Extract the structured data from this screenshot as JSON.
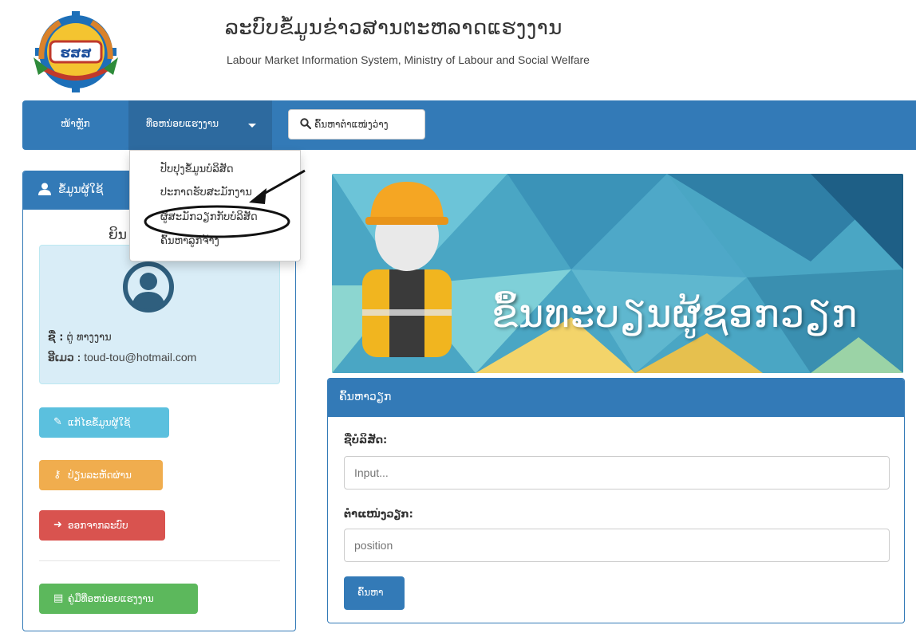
{
  "header": {
    "title": "ລະບົບຂໍ້ມູນຂ່າວສານຕະຫລາດແຮງງານ",
    "subtitle": "Labour Market Information System, Ministry of Labour and Social Welfare",
    "logo_text": "ຮສສ"
  },
  "nav": {
    "home": "ໜ້າຫຼັກ",
    "dropdown": "ທີ່ອຫນ່ອຍແຮງງານ",
    "search_button": "ຄົ້ນຫາຕໍາແໜ່ງວ່າງ"
  },
  "dropdown_menu": {
    "items": [
      "ປັບປຸງຂໍ້ມູນບໍລິສັດ",
      "ປະກາດຮັບສະມັກງານ",
      "ຜູ້ສະມັກວຽກກັບບໍລິສັດ",
      "ຄົ້ນຫາລູກຈ້າງ"
    ]
  },
  "user_panel": {
    "title": "ຂໍ້ມູນຜູ້ໃຊ້",
    "welcome": "ຍິນ",
    "name_label": "ຊື່ :",
    "name_value": "ຕູ່ ທາງງານ",
    "email_label": "ອີເມວ :",
    "email_value": "toud-tou@hotmail.com",
    "buttons": {
      "edit": "ແກ້ໄຂຂໍ້ມູນຜູ້ໃຊ້",
      "password": "ປ່ຽນລະຫັດຜ່ານ",
      "logout": "ອອກຈາກລະບົບ",
      "manual": "ຄູ່ມືທີ່ອຫນ່ອຍແຮງງານ"
    }
  },
  "banner": {
    "title": "ຂຶ້ນທະບຽນຜູ້ຊອກວຽກ"
  },
  "search": {
    "title": "ຄົ້ນຫາວຽກ",
    "company_label": "ຊື່ບໍລິສັດ:",
    "company_placeholder": "Input...",
    "position_label": "ຕໍາແໜ່ງວຽກ:",
    "position_placeholder": "position",
    "submit": "ຄົ້ນຫາ"
  },
  "colors": {
    "primary": "#337ab7",
    "info": "#5bc0de",
    "warning": "#f0ad4e",
    "danger": "#d9534f",
    "success": "#5cb85c"
  }
}
